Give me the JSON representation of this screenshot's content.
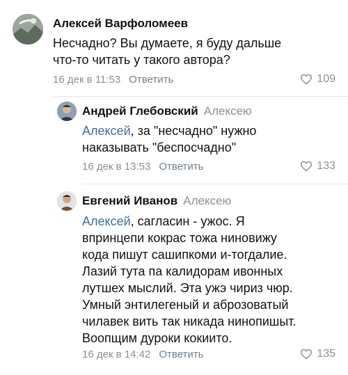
{
  "comments": [
    {
      "author": "Алексей Варфоломеев",
      "reply_to": "",
      "mention": "",
      "text_lines": [
        "Несчадно? Вы думаете, я буду дальше",
        "что-то читать у такого автора?"
      ],
      "time": "16 дек в 11:53",
      "reply_label": "Ответить",
      "likes": "109"
    },
    {
      "author": "Андрей Глебовский",
      "reply_to": "Алексею",
      "mention": "Алексей",
      "text_lines": [
        ", за \"несчадно\" нужно",
        "наказывать \"беспосчадно\""
      ],
      "time": "16 дек в 13:53",
      "reply_label": "Ответить",
      "likes": "133"
    },
    {
      "author": "Евгений Иванов",
      "reply_to": "Алексею",
      "mention": "Алексей",
      "text_lines": [
        ", сагласин - ужос. Я",
        "впринцепи кокрас тожа ниновижу",
        "кода пишут сашипкоми и-тогдалие.",
        "Лазий тута па калидорам ивонных",
        "лутшех мыслий. Эта ужэ чириз чюр.",
        "Умный энтилегеный и аброзоватый",
        "чилавек вить так никада нинопишыт.",
        "Воопщим дуроки кокиито."
      ],
      "time": "16 дек в 14:42",
      "reply_label": "Ответить",
      "likes": "135"
    }
  ],
  "colors": {
    "mention": "#3b6ea8",
    "meta": "#8a8f96"
  }
}
